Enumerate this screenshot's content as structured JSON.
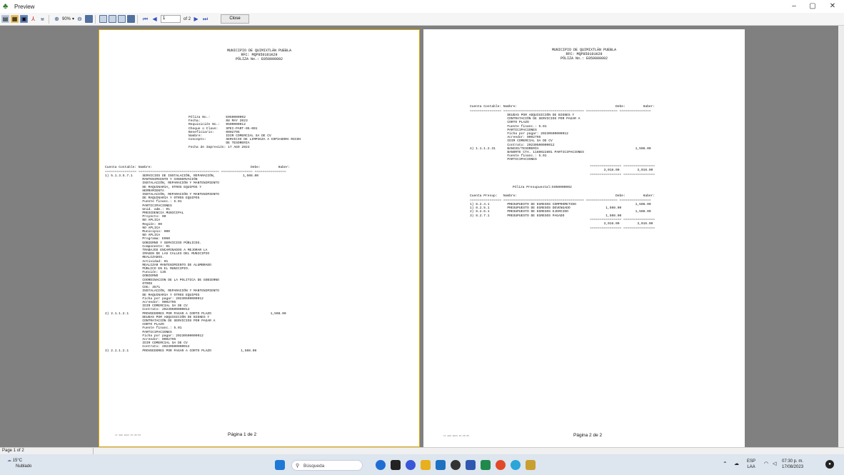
{
  "window": {
    "title": "Preview",
    "minimize": "–",
    "maximize": "▢",
    "close": "✕"
  },
  "toolbar": {
    "zoom": "90%",
    "page_input": "1",
    "page_of": "of 2",
    "close_label": "Close"
  },
  "page1": {
    "header": [
      "MUNICIPIO DE QUIMIXTLÁN PUEBLA",
      "RFC: MQP850101K29",
      "PÓLIZA No.: E050000002"
    ],
    "info": [
      "Póliza No.:        E050000002",
      "Fecha:             08 MAY 2023",
      "Requisición No.:   0500000012",
      "Cheque o Clave:    SPEI-PART-05-001",
      "Beneficiario:      0002795",
      "Nombre:            IDIR COMERCIAL SA DE CV",
      "Concepto:          SERVICIO DE LIMPIEZA A COPIADORA RICOH",
      "                   DE TESORERIA",
      "Fecha de Impresión: 17 AGO 2023"
    ],
    "col_header": "Cuenta Contable: Nombre:                                                  Debe:         Haber:",
    "rule": "================ ========================================= ================ ================",
    "rows": [
      "1) 5.1.3.5.7.1     SERVICIOS DE INSTALACIÓN, REPARACIÓN,              1,508.00",
      "                   MANTENIMIENTO Y CONSERVACIÓN",
      "                   INSTALACIÓN, REPARACIÓN Y MANTENIMIENTO",
      "                   DE MAQUINARIA, OTROS EQUIPOS Y",
      "                   HERRAMIENTA",
      "                   INSTALACIÓN, REPARACIÓN Y MANTENIMIENTO",
      "                   DE MAQUINARIA Y OTROS EQUIPOS",
      "                   Fuente financ.: 5.01",
      "                   PARTICIPACIONES",
      "                   Unid. adm.: 01",
      "                   PRESIDENCIA MUNICIPAL",
      "                   Proyecto: 00",
      "                   NO APLICA",
      "                   Región: 00",
      "                   NO APLICA",
      "                   Municipio: 000",
      "                   NO APLICA",
      "                   Programa: E060",
      "                   GOBIERNO Y SERVICIOS PÚBLICOS.",
      "                   Componente: 01",
      "                   TRABAJOS ENCAMINADOS A MEJORAR LA",
      "                   IMAGEN DE LAS CALLES DEL MUNICIPIO",
      "                   REALIZADOS.",
      "                   Actividad: 01",
      "                   REALIZAR MANTENIMIENTO DE ALUMBRADO",
      "                   PÚBLICO EN EL MUNICIPIO.",
      "                   Función: 135",
      "                   GOBIERNO",
      "                   COORDINACION DE LA POLITICA DE GOBIERNO",
      "                   OTROS",
      "                   COG: 3571",
      "                   INSTALACIÓN, REPARACIÓN Y MANTENIMIENTO",
      "                   DE MAQUINARIA Y OTROS EQUIPOS",
      "                   Ficha por pagar: 20230500000012",
      "                   Acreedor: 0002795",
      "                   IDIR COMERCIAL SA DE CV",
      "                   Contrato: 20230500000012",
      "2) 2.1.1.2.1       PROVEEDORES POR PAGAR A CORTO PLAZO                              1,508.00",
      "                   DEUDAS POR ADQUISICIÓN DE BIENES Y",
      "                   CONTRATACIÓN DE SERVICIOS POR PAGAR A",
      "                   CORTO PLAZO",
      "                   Fuente financ.: 5.01",
      "                   PARTICIPACIONES",
      "                   Ficha por pagar: 20230500000012",
      "                   Acreedor: 0002795",
      "                   IDIR COMERCIAL SA DE CV",
      "                   Contrato: 20230500000012",
      "3) 2.1.1.2.1       PROVEEDORES POR PAGAR A CORTO PLAZO               1,508.00"
    ],
    "print_stamp": "17 AGO 2023 15:35:55",
    "footer": "Página 1 de 2"
  },
  "page2": {
    "header": [
      "MUNICIPIO DE QUIMIXTLÁN PUEBLA",
      "RFC: MQP850101K29",
      "PÓLIZA No.: E050000002"
    ],
    "col_header": "Cuenta Contable: Nombre:                                                  Debe:         Haber:",
    "rule": "================ ========================================= ================ ================",
    "rows": [
      "                   DEUDAS POR ADQUISICIÓN DE BIENES Y",
      "                   CONTRATACIÓN DE SERVICIOS POR PAGAR A",
      "                   CORTO PLAZO",
      "                   Fuente financ.: 5.01",
      "                   PARTICIPACIONES",
      "                   Ficha por pagar: 20230500000012",
      "                   Acreedor: 0002795",
      "                   IDIR COMERCIAL SA DE CV",
      "                   Contrato: 20230500000012",
      "4) 1.1.1.2.31      BANCOS/TESORERÍA                                                 1,508.00",
      "                   BANORTE CTA. 1160022801 PARTICIPACIONES",
      "                   Fuente financ.: 5.01",
      "                   PARTICIPACIONES"
    ],
    "totals_rule": "                                                             ================ ================",
    "totals": "                                                                    3,016.00         3,016.00",
    "budget_title": "Póliza Presupuestal:E050000002",
    "budget_header": "Cuenta Presup:   Nombre:                                                  Debe:         Haber:",
    "budget_rows": [
      "1) 8.2.4.1         PRESUPUESTO DE EGRESOS COMPROMETIDO                              1,508.00",
      "1) 8.2.5.1         PRESUPUESTO DE EGRESOS DEVENGADO                  1,508.00",
      "2) 8.2.6.1         PRESUPUESTO DE EGRESOS EJERCIDO                                  1,508.00",
      "3) 8.2.7.1         PRESUPUESTO DE EGRESOS PAGADO                     1,508.00"
    ],
    "budget_totals": "                                                                    3,016.00         3,016.00",
    "print_stamp": "17 AGO 2023 15:35:55",
    "footer": "Página 2 de 2"
  },
  "status": {
    "page_text": "Page 1 of 2"
  },
  "taskbar": {
    "temp": "15°C",
    "weather": "Nublado",
    "search": "Búsqueda",
    "lang1": "ESP",
    "lang2": "LAA",
    "time": "07:30 p. m.",
    "date": "17/08/2023"
  }
}
